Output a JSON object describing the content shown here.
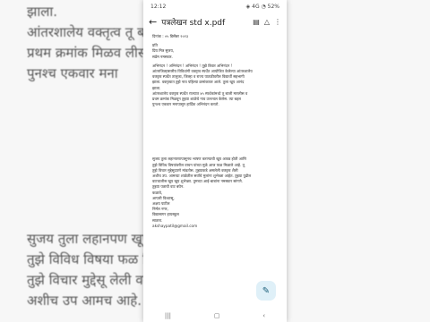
{
  "background": {
    "top_lines": [
      "झाला.",
      "आंतरशालेय वक्तृत्व                              तू बाजी मारलीस व",
      "प्रथम क्रमांक मिळव                              लीस. त्या बद्दल",
      "पुनश्च एकवार मना"
    ],
    "bottom_lines": [
      "सुजय तुला लहानपण                              खूप आवड होती आणि",
      "तुझे विविध विषया                              फळ मिळाले आहे. तू",
      "तुझे विचार मुद्देसू                             लेली वक्तृत्व शैली",
      "अशीच उप  आमच                              आहे. उद्या पदील"
    ]
  },
  "status_bar": {
    "time": "12:12",
    "right": "◈ 4G ◔ 52%"
  },
  "app_bar": {
    "title": "पत्रलेखन std x.pdf",
    "back_icon": "arrow-left-icon",
    "actions": [
      "document-icon",
      "drive-icon",
      "more-icon"
    ]
  },
  "letter": {
    "date": "दिनांक : ०५ डिसेंबर २०२३",
    "greeting_lines": [
      "प्रति",
      "प्रिय मित्र सुजय,",
      "सप्रेम नमस्कार."
    ],
    "para1": [
      "अभिनंदन ! अभिनंदन ! अभिनंदन ! तुझे त्रिवार अभिनंदन !",
      "आंतरजिल्हास्तरीय विविधांगी वक्तृत्व स्पर्धेत आयोजित केलेल्या आंतरशालेय",
      "वक्तृत्व स्पर्धेत तालुका, जिल्हा व राज्य पातळीवरील विद्यार्थी सहभागी",
      "झाला. वक्तृत्वात तुझे नाव पहिल्या क्रमांकावर आले. तुला खूप आनंद",
      "झाला."
    ],
    "para2": [
      "आंतरशालेय वक्तृत्व स्पर्धेत राज्यात ४५ स्पर्धकांमध्ये तू बाजी मारलीस व",
      "प्रथम क्रमांक मिळवून तुझ्या शाळेचे नाव उज्ज्वल केलेस. त्या बद्दल",
      "पुनश्च एकवार मनापासून हार्दिक अभिनंदन करतो."
    ],
    "para3": [
      "सुजय तुला लहानपणापासूनच भाषण करण्याची खूप आवड होती आणि",
      "तुझे विविध विषयांवरील वाचन यांच्या मुळे आज फळ मिळाले आहे. तू",
      "तुझे विचार मुद्देसूदपणे मांडतोस. तुझ्याकडे असलेली वक्तृत्व शैली",
      "अशीच उप. आमच्या शाळेतील सर्वांचे मुलांना शुभेच्छा आहेत. तुझ्या पुढील",
      "वाटचालीस खूप खूप शुभेच्छा. तुमच्या आई-बाबांना नमस्कार सांगणे.",
      "तुझ्या पत्राची वाट बघेन."
    ],
    "closing": [
      "कळावे,",
      "आपली विश्वासू,",
      "अक्षय पाटील",
      "निर्मल नगर,",
      "विद्यासागर हायस्कूल",
      "सातारा.",
      "akshaypatil@gmail.com"
    ]
  },
  "fab_icon": "edit-sparkle-icon",
  "nav": [
    "menu-icon",
    "home-icon",
    "back-icon"
  ]
}
